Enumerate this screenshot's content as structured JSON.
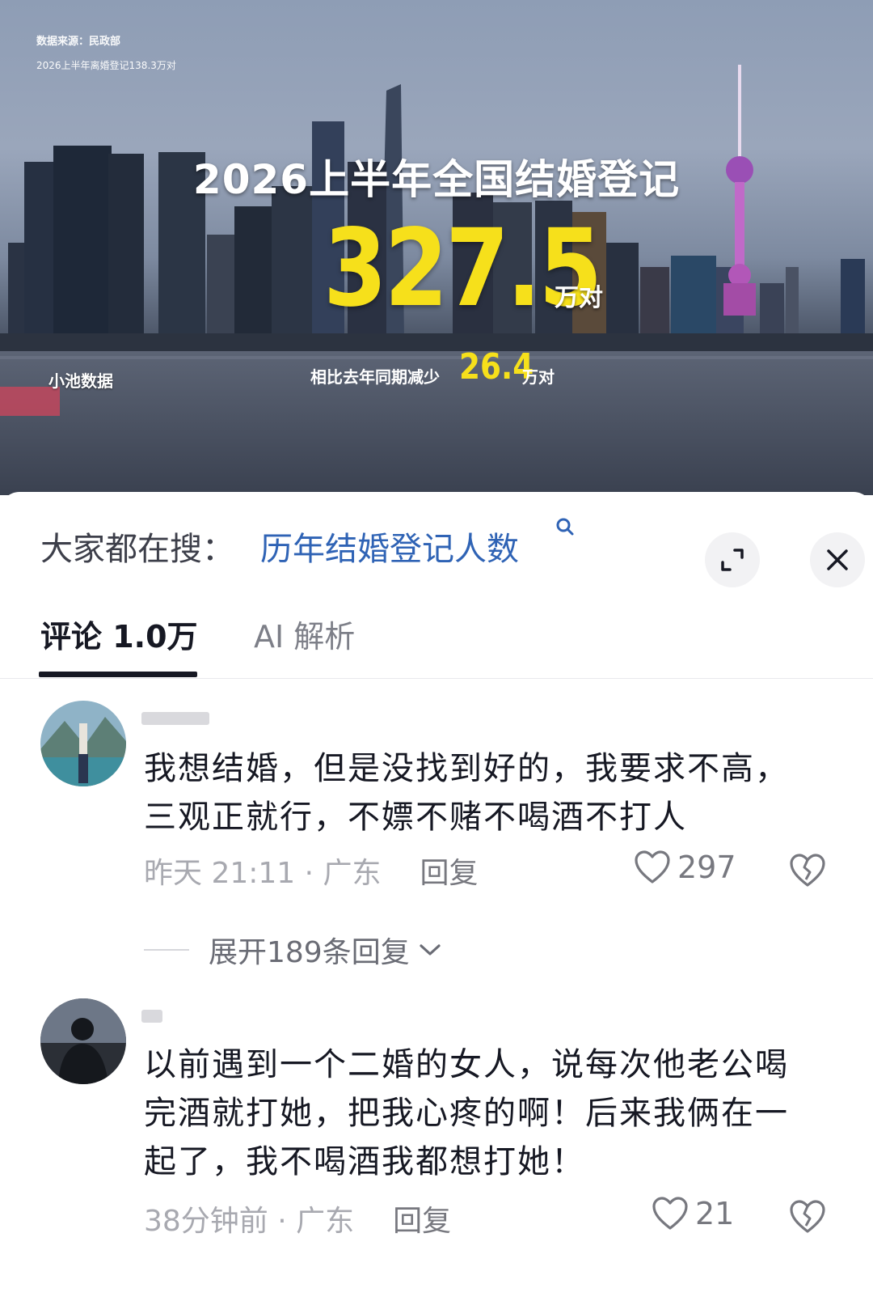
{
  "video": {
    "source_line": "数据来源：民政部",
    "sub_line": "2026上半年离婚登记138.3万对",
    "title": "2026上半年全国结婚登记",
    "big_number": "327.5",
    "big_unit": "万对",
    "compare_text": "相比去年同期减少",
    "compare_number": "26.4",
    "compare_unit": "万对",
    "watermark": "小池数据"
  },
  "search": {
    "prefix": "大家都在搜：",
    "query": "历年结婚登记人数"
  },
  "tabs": [
    {
      "label": "评论 1.0万",
      "active": true
    },
    {
      "label": "AI 解析",
      "active": false
    }
  ],
  "comments": [
    {
      "text": "我想结婚，但是没找到好的，我要求不高，三观正就行，不嫖不赌不喝酒不打人",
      "time": "昨天 21:11 · 广东",
      "reply_label": "回复",
      "likes": "297",
      "expand_label": "展开189条回复"
    },
    {
      "text": "以前遇到一个二婚的女人，说每次他老公喝完酒就打她，把我心疼的啊！后来我俩在一起了，我不喝酒我都想打她！",
      "time": "38分钟前 · 广东",
      "reply_label": "回复",
      "likes": "21"
    }
  ],
  "colors": {
    "accent_yellow": "#f6e01b",
    "link_blue": "#2f63b5",
    "text_primary": "#161823",
    "text_secondary": "#a8a9b0"
  },
  "icons": [
    "search-icon",
    "expand-icon",
    "close-icon",
    "heart-icon",
    "broken-heart-icon",
    "chevron-down-icon"
  ]
}
